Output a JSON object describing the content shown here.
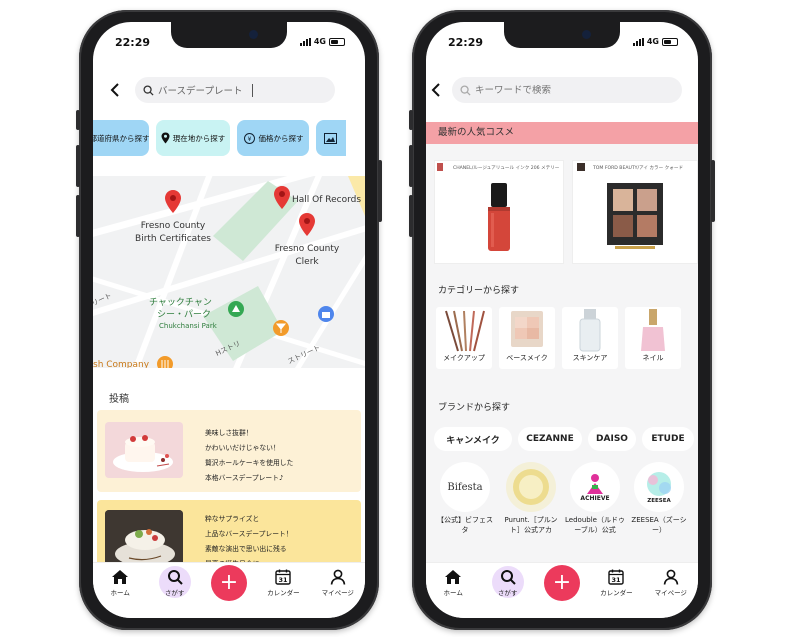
{
  "left_phone": {
    "status": {
      "time": "22:29",
      "network": "4G"
    },
    "search": {
      "placeholder": "バースデープレート"
    },
    "chips": [
      {
        "label": "都道府県から探す",
        "icon": "map-icon"
      },
      {
        "label": "現在地から探す",
        "icon": "location-pin-icon"
      },
      {
        "label": "価格から探す",
        "icon": "price-icon"
      },
      {
        "label": "",
        "icon": "image-icon"
      }
    ],
    "map": {
      "places": [
        {
          "name_line1": "Fresno County",
          "name_line2": "Birth Certificates"
        },
        {
          "name_line1": "Hall Of Records",
          "name_line2": ""
        },
        {
          "name_line1": "Fresno County",
          "name_line2": "Clerk"
        }
      ],
      "park_line1": "チャックチャン",
      "park_line2": "シー・パーク",
      "park_en": "Chukchansi Park",
      "company": "sh Company",
      "street1": "リート",
      "street2": "Hストリ",
      "street3": "ストリート"
    },
    "posts_title": "投稿",
    "posts": [
      {
        "lines": [
          "美味しさ抜群！",
          "かわいいだけじゃない！",
          "贅沢ホールケーキを使用した",
          "本格バースデープレート♪"
        ],
        "bg": "#fdf1d6"
      },
      {
        "lines": [
          "粋なサプライズと",
          "上品なバースデープレート！",
          "素敵な演出で思い出に残る",
          "最高の誕生日会に。"
        ],
        "bg": "#fbe59b"
      }
    ],
    "tabs": [
      {
        "label": "ホーム",
        "icon": "home-icon"
      },
      {
        "label": "さがす",
        "icon": "search-icon"
      },
      {
        "label": "+",
        "icon": "plus-icon"
      },
      {
        "label": "カレンダー",
        "icon": "calendar-icon",
        "day": "31"
      },
      {
        "label": "マイページ",
        "icon": "person-icon"
      }
    ]
  },
  "right_phone": {
    "status": {
      "time": "22:29",
      "network": "4G"
    },
    "search": {
      "placeholder": "キーワードで検索"
    },
    "banner": "最新の人気コスメ",
    "products": [
      {
        "title": "CHANEL/ルージュアリュール インク 206 メテリー"
      },
      {
        "title": "TOM FORD BEAUTY/アイ カラー クォード"
      }
    ],
    "category_title": "カテゴリーから探す",
    "categories": [
      "メイクアップ",
      "ベースメイク",
      "スキンケア",
      "ネイル"
    ],
    "brand_title": "ブランドから探す",
    "brand_pills": [
      "キャンメイク",
      "CEZANNE",
      "DAISO",
      "ETUDE"
    ],
    "brand_logos": [
      {
        "logo_text": "Bifesta",
        "name": "【公式】ビフェスタ"
      },
      {
        "logo_text": "",
        "name": "Purunt.［プルント］公式アカ"
      },
      {
        "logo_text": "ACHIEVE",
        "name": "Ledouble（ルドゥーブル）公式"
      },
      {
        "logo_text": "ZEESEA",
        "name": "ZEESEA（ズーシー）"
      }
    ],
    "tabs": [
      {
        "label": "ホーム"
      },
      {
        "label": "さがす"
      },
      {
        "label": "+"
      },
      {
        "label": "カレンダー",
        "day": "31"
      },
      {
        "label": "マイページ"
      }
    ]
  },
  "colors": {
    "accent_plus": "#ec3a5c",
    "search_tab_highlight": "#ecdcfa",
    "banner": "#f4a1a6",
    "chip_blue": "#9fd6f5",
    "chip_cyan": "#c9f3f3",
    "map_pin": "#e53935"
  }
}
